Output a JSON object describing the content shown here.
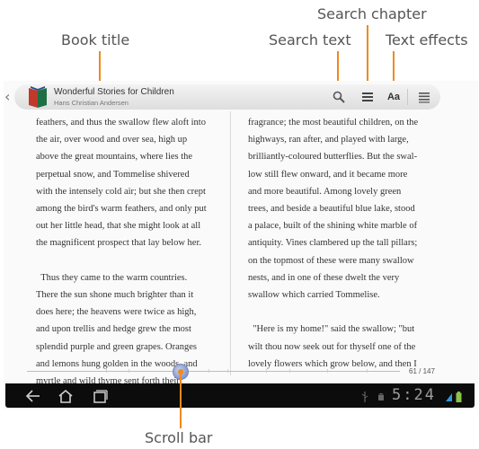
{
  "annotations": {
    "book_title": "Book title",
    "search_text": "Search text",
    "search_chapter": "Search chapter",
    "text_effects": "Text effects",
    "scroll_bar": "Scroll bar"
  },
  "book": {
    "title": "Wonderful Stories for Children",
    "author": "Hans Christian Andersen"
  },
  "icons": {
    "back": "chevron-left-icon",
    "book": "book-icon",
    "search": "search-icon",
    "chapters": "chapter-list-icon",
    "text_effects": "text-effects-icon",
    "menu": "menu-icon",
    "text_effects_label": "Aa"
  },
  "pages": {
    "left": [
      "feathers, and thus the swallow flew aloft into",
      "the air, over wood and over sea, high up",
      "above the great mountains, where lies the",
      "perpetual snow, and Tommelise shivered",
      "with the intensely cold air; but she then crept",
      "among the bird's warm feathers, and only put",
      "out her little head, that she might look at all",
      "the magnificent prospect that lay below her.",
      "",
      "  Thus they came to the warm countries.",
      "There the sun shone much brighter than it",
      "does here; the heavens were twice as high,",
      "and upon trellis and hedge grew the most",
      "splendid purple and green grapes. Oranges",
      "and lemons hung golden in the woods, and",
      "myrtle and wild thyme sent forth their"
    ],
    "right": [
      "fragrance; the most beautiful children, on the",
      "highways, ran after, and played with large,",
      "brilliantly-coloured butterflies. But the swal-",
      "low still flew onward, and it became more",
      "and more beautiful. Among lovely green",
      "trees, and beside a beautiful blue lake, stood",
      "a palace, built of the shining white marble of",
      "antiquity. Vines clambered up the tall pillars;",
      "on the topmost of these were many swallow",
      "nests, and in one of these dwelt the very",
      "swallow which carried Tommelise.",
      "",
      "  \"Here is my home!\" said the swallow; \"but",
      "wilt thou now seek out for thyself one of the",
      "lovely flowers which grow below, and then I"
    ]
  },
  "progress": {
    "label": "61 / 147",
    "current_page": 61,
    "total_pages": 147
  },
  "status": {
    "time": "5:24"
  },
  "colors": {
    "accent": "#f08a1c",
    "navbar": "#0c0c0c",
    "scroll_thumb": "#8f9fcf"
  }
}
